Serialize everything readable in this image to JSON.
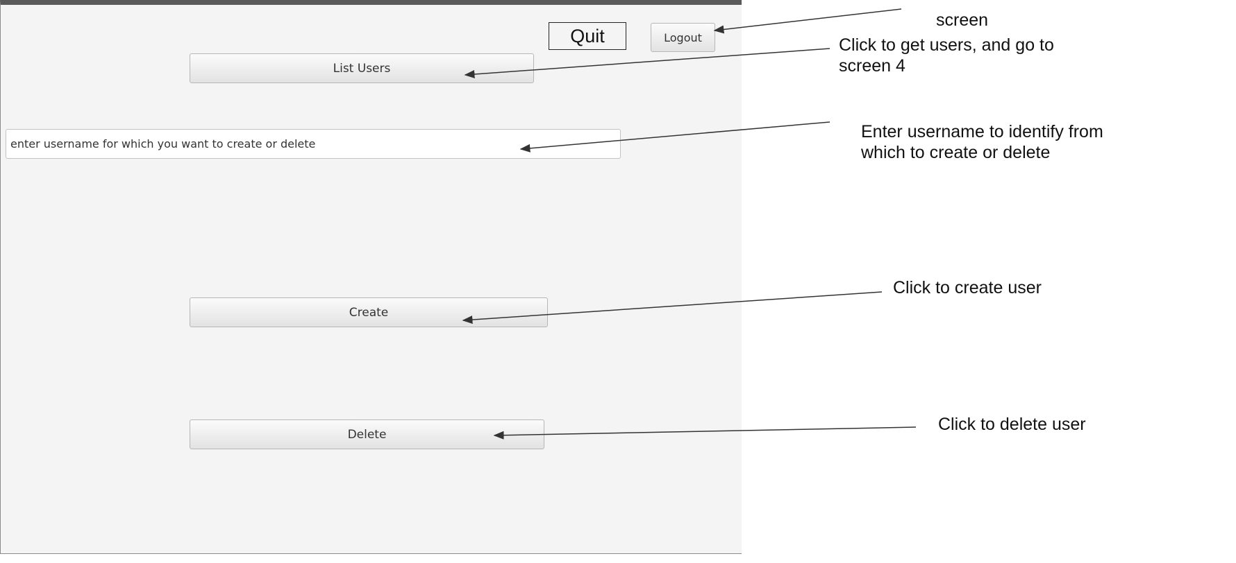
{
  "app": {
    "quit_label": "Quit",
    "logout_label": "Logout",
    "list_users_label": "List Users",
    "username_placeholder": "enter username for which you want to create or delete",
    "username_value": "",
    "create_label": "Create",
    "delete_label": "Delete"
  },
  "annotations": {
    "logout": "screen",
    "list_users": "Click to get users, and go to screen 4",
    "username": "Enter username to identify from which to create or delete",
    "create": "Click to create user",
    "delete": "Click to delete user"
  },
  "colors": {
    "window_background": "#f4f4f4",
    "title_bar": "#5a5a5a",
    "arrow": "#333333"
  }
}
